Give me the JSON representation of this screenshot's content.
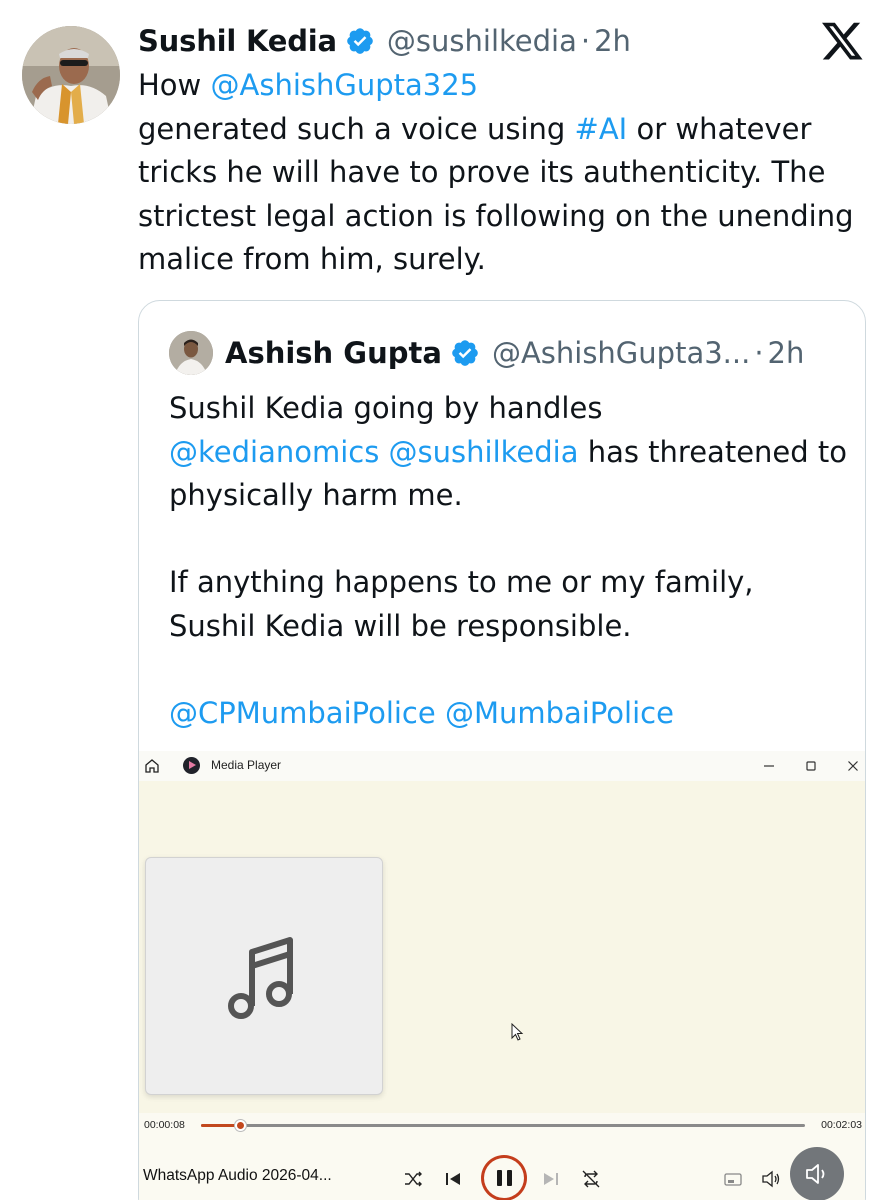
{
  "tweet": {
    "author_name": "Sushil Kedia",
    "author_handle": "@sushilkedia",
    "separator": "·",
    "time": "2h",
    "body": {
      "prefix": "How ",
      "mention": "@AshishGupta325",
      "line2_a": " generated such a voice using ",
      "hashtag": "#AI",
      "line2_b": " or whatever tricks he will have to prove its authenticity. The strictest legal action is following on the unending malice from him, surely."
    }
  },
  "quote": {
    "author_name": "Ashish Gupta",
    "author_handle": "@AshishGupta3...",
    "separator": "·",
    "time": "2h",
    "p1_a": "Sushil Kedia going by handles",
    "p1_m1": "@kedianomics",
    "p1_space": " ",
    "p1_m2": "@sushilkedia",
    "p1_b": " has threatened to physically harm me.",
    "p2": "If anything happens to me or my family, Sushil Kedia will be responsible.",
    "p3_m1": "@CPMumbaiPolice",
    "p3_space": " ",
    "p3_m2": "@MumbaiPolice"
  },
  "media_player": {
    "app_title": "Media Player",
    "current_time": "00:00:08",
    "total_time": "00:02:03",
    "progress_fraction": 0.065,
    "track_name": "WhatsApp Audio 2026-04...",
    "state": "playing"
  },
  "icons": {
    "verified": "verified-badge-icon",
    "x_logo": "x-logo-icon",
    "music_note": "music-note-icon"
  },
  "colors": {
    "link": "#1d9bf0",
    "verified": "#1d9bf0",
    "player_accent": "#c2481e"
  }
}
